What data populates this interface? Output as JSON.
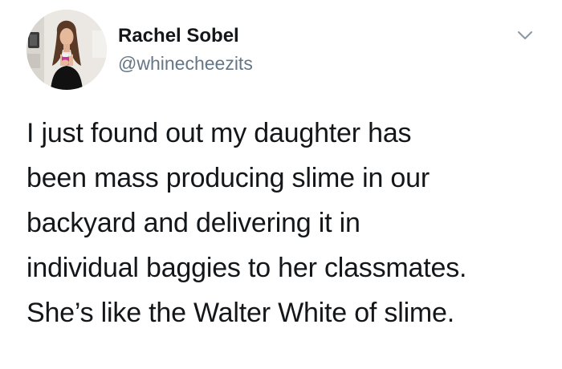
{
  "tweet": {
    "author": {
      "display_name": "Rachel Sobel",
      "handle": "@whinecheezits",
      "avatar_icon": "profile-photo"
    },
    "menu_icon": "chevron-down-icon",
    "text_lines": [
      "I just found out my daughter has",
      "been mass producing slime in our",
      "backyard and delivering it in",
      "individual baggies to her classmates.",
      "She’s like the Walter White of slime."
    ]
  },
  "colors": {
    "text": "#14171a",
    "secondary_text": "#657786",
    "caret": "#8899a6",
    "background": "#ffffff"
  }
}
